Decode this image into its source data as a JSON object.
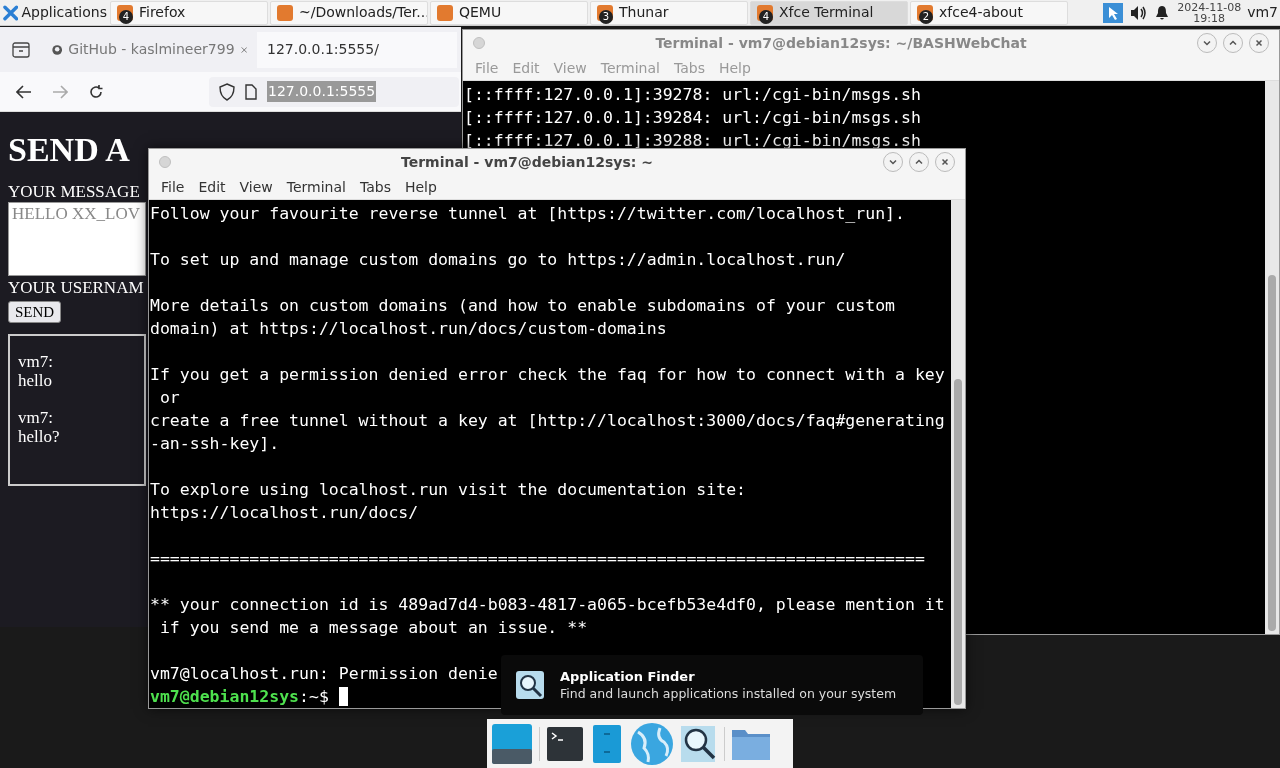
{
  "panel": {
    "menu": "Applications",
    "tasks": [
      {
        "label": "Firefox",
        "badge": "4",
        "selected": false
      },
      {
        "label": "~/Downloads/Ter...",
        "selected": false
      },
      {
        "label": "QEMU",
        "selected": false
      },
      {
        "label": "Thunar",
        "badge": "3",
        "selected": false
      },
      {
        "label": "Xfce Terminal",
        "badge": "4",
        "selected": true
      },
      {
        "label": "xfce4-about",
        "badge": "2",
        "selected": false
      }
    ],
    "date": "2024-11-08",
    "time": "19:18",
    "user": "vm7"
  },
  "browser": {
    "tabs": [
      {
        "label": "GitHub - kaslmineer799",
        "selected": false
      },
      {
        "label": "127.0.0.1:5555/",
        "selected": true
      }
    ],
    "address": "127.0.0.1:5555",
    "page": {
      "heading": "SEND A",
      "message_label": "YOUR MESSAGE",
      "message_value": "HELLO XX_LOV",
      "username_label": "YOUR USERNAM",
      "send": "SEND",
      "messages": [
        {
          "user": "vm7:",
          "text": "hello"
        },
        {
          "user": "vm7:",
          "text": "hello?"
        }
      ]
    }
  },
  "back_terminal": {
    "title": "Terminal - vm7@debian12sys: ~/BASHWebChat",
    "menu": [
      "File",
      "Edit",
      "View",
      "Terminal",
      "Tabs",
      "Help"
    ],
    "lines": [
      "[::ffff:127.0.0.1]:39278: url:/cgi-bin/msgs.sh",
      "[::ffff:127.0.0.1]:39284: url:/cgi-bin/msgs.sh",
      "[::ffff:127.0.0.1]:39288: url:/cgi-bin/msgs.sh"
    ]
  },
  "front_terminal": {
    "title": "Terminal - vm7@debian12sys: ~",
    "menu": [
      "File",
      "Edit",
      "View",
      "Terminal",
      "Tabs",
      "Help"
    ],
    "blocks": [
      [
        "Follow your favourite reverse tunnel at [https://twitter.com/localhost_run]."
      ],
      [
        "To set up and manage custom domains go to https://admin.localhost.run/"
      ],
      [
        "More details on custom domains (and how to enable subdomains of your custom",
        "domain) at https://localhost.run/docs/custom-domains"
      ],
      [
        "If you get a permission denied error check the faq for how to connect with a key",
        " or",
        "create a free tunnel without a key at [http://localhost:3000/docs/faq#generating",
        "-an-ssh-key]."
      ],
      [
        "To explore using localhost.run visit the documentation site:",
        "https://localhost.run/docs/"
      ],
      [
        "=============================================================================="
      ],
      [
        "** your connection id is 489ad7d4-b083-4817-a065-bcefb53e4df0, please mention it",
        " if you send me a message about an issue. **"
      ],
      [
        "vm7@localhost.run: Permission denie"
      ]
    ],
    "prompt_user": "vm7@debian12sys",
    "prompt_path": ":~$"
  },
  "tooltip": {
    "title": "Application Finder",
    "description": "Find and launch applications installed on your system"
  }
}
